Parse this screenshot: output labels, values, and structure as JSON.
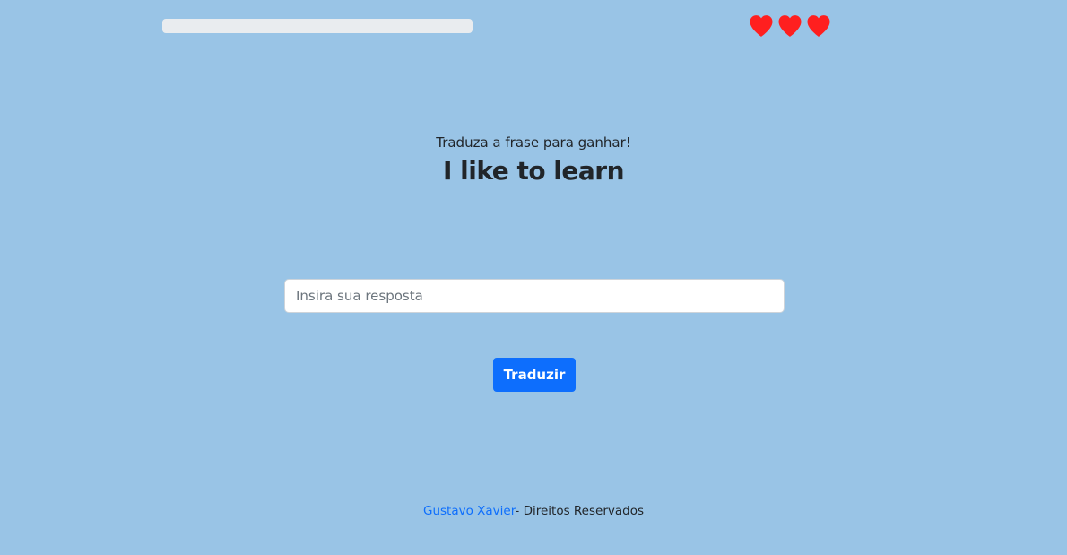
{
  "header": {
    "progress_percent": 0,
    "lives": 3,
    "heart_color": "#ff1f1f",
    "progress_track_color": "#e9ecef",
    "heart_icon": "heart-icon"
  },
  "main": {
    "instruction": "Traduza a frase para ganhar!",
    "phrase": "I like to learn",
    "answer_input": {
      "value": "",
      "placeholder": "Insira sua resposta"
    },
    "translate_button_label": "Traduzir"
  },
  "footer": {
    "author_link": "Gustavo Xavier",
    "rights_text": "- Direitos Reservados"
  },
  "colors": {
    "background": "#99c4e6",
    "primary_button": "#0d6efd",
    "link": "#0d6efd"
  }
}
